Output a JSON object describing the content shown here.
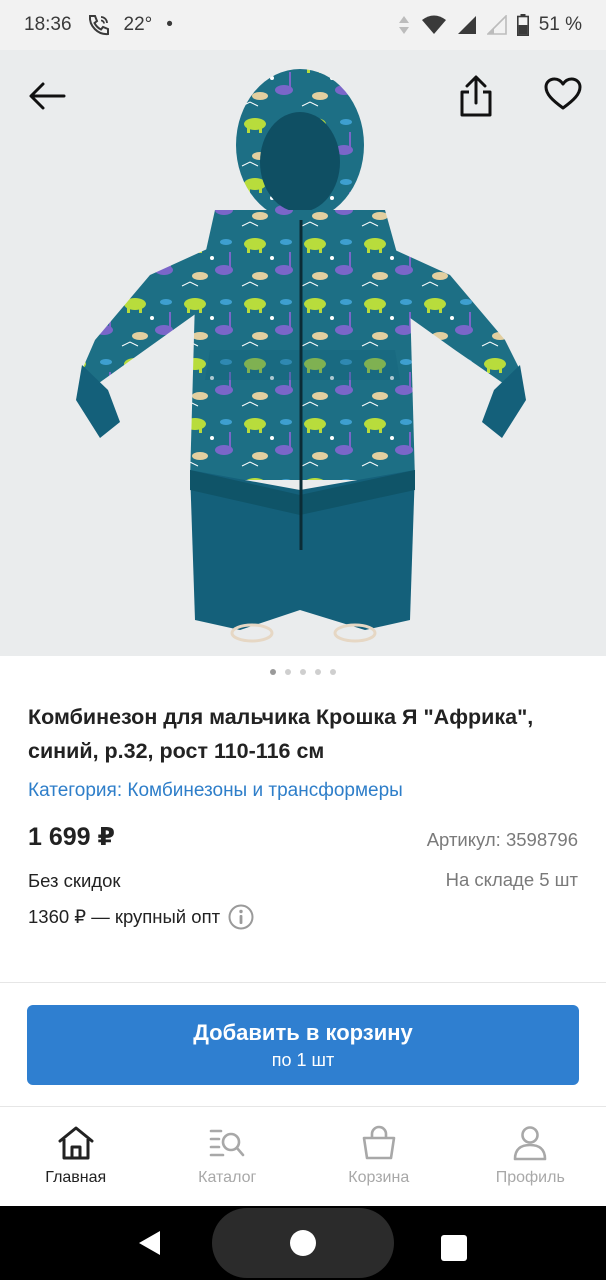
{
  "status_bar": {
    "time": "18:36",
    "temperature": "22°",
    "bullet": "•",
    "battery": "51 %"
  },
  "product": {
    "image_alt": "Комбинезон для мальчика Крошка Я Африка",
    "title": "Комбинезон для мальчика Крошка Я \"Африка\", синий, р.32, рост 110-116 см",
    "category": "Категория: Комбинезоны и трансформеры",
    "price": "1 699 ₽",
    "sku": "Артикул: 3598796",
    "discount": "Без скидок",
    "stock": "На складе 5 шт",
    "wholesale": "1360 ₽ — крупный опт",
    "carousel_dots": 5,
    "carousel_active": 0
  },
  "cart": {
    "button_label": "Добавить в корзину",
    "button_sub": "по 1 шт"
  },
  "tabs": [
    {
      "label": "Главная",
      "icon": "home-icon",
      "active": true
    },
    {
      "label": "Каталог",
      "icon": "catalog-search-icon",
      "active": false
    },
    {
      "label": "Корзина",
      "icon": "basket-icon",
      "active": false
    },
    {
      "label": "Профиль",
      "icon": "profile-icon",
      "active": false
    }
  ],
  "colors": {
    "accent": "#2f7fd0",
    "link": "#2e7ec9",
    "suit_teal": "#14607a",
    "suit_print": "#1d6f85"
  }
}
